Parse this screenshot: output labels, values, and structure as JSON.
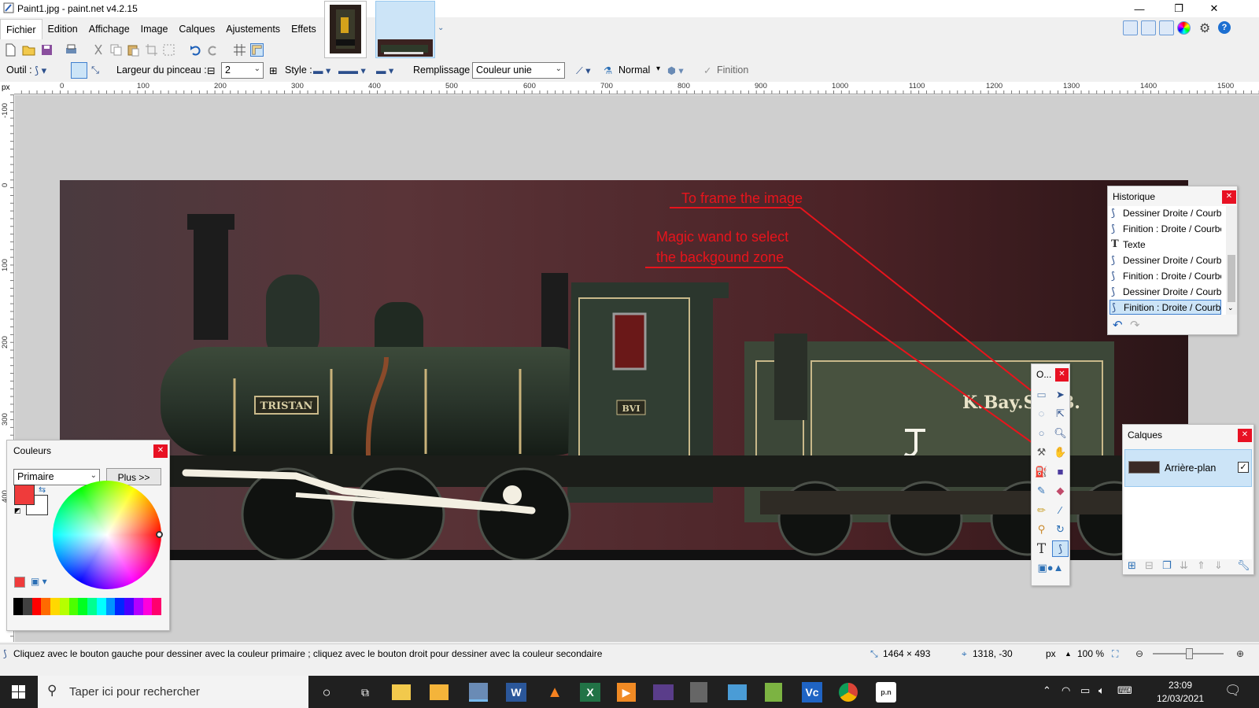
{
  "window": {
    "title": "Paint1.jpg - paint.net v4.2.15",
    "minimize": "—",
    "restore": "❐",
    "close": "✕"
  },
  "menu": [
    "Fichier",
    "Edition",
    "Affichage",
    "Image",
    "Calques",
    "Ajustements",
    "Effets"
  ],
  "toolbar2": {
    "tool_label": "Outil :",
    "brush_width_label": "Largeur du pinceau :",
    "brush_width_value": "2",
    "style_label": "Style :",
    "fill_label": "Remplissage :",
    "fill_value": "Couleur unie",
    "blend_mode": "Normal",
    "finish_label": "Finition"
  },
  "rulers": {
    "unit": "px",
    "h_labels": [
      "0",
      "100",
      "200",
      "300",
      "400",
      "500",
      "600",
      "700",
      "800",
      "900",
      "1000",
      "1100",
      "1200",
      "1300",
      "1400",
      "1500"
    ],
    "v_labels": [
      "-100",
      "0",
      "100",
      "200",
      "300",
      "400"
    ]
  },
  "annotations": {
    "frame": "To frame the image",
    "wand_line1": "Magic wand to select",
    "wand_line2": "the backgound zone",
    "color": "#e8141c"
  },
  "history": {
    "title": "Historique",
    "items": [
      {
        "icon": "draw-line-icon",
        "label": "Dessiner Droite / Courbe",
        "selected": false
      },
      {
        "icon": "finish-line-icon",
        "label": "Finition : Droite / Courbe",
        "selected": false
      },
      {
        "icon": "text-icon",
        "label": "Texte",
        "selected": false
      },
      {
        "icon": "draw-line-icon",
        "label": "Dessiner Droite / Courbe",
        "selected": false
      },
      {
        "icon": "finish-line-icon",
        "label": "Finition : Droite / Courbe",
        "selected": false
      },
      {
        "icon": "draw-line-icon",
        "label": "Dessiner Droite / Courbe",
        "selected": false
      },
      {
        "icon": "finish-line-icon",
        "label": "Finition : Droite / Courbe",
        "selected": true
      }
    ]
  },
  "tools_panel": {
    "title": "O..."
  },
  "layers": {
    "title": "Calques",
    "items": [
      {
        "label": "Arrière-plan",
        "visible": true
      }
    ]
  },
  "colors": {
    "title": "Couleurs",
    "mode": "Primaire",
    "more_button": "Plus >>",
    "primary_color": "#ef3b3b",
    "secondary_color": "#ffffff",
    "palette": [
      "#000000",
      "#404040",
      "#ff0000",
      "#ff6a00",
      "#ffd800",
      "#b6ff00",
      "#4cff00",
      "#00ff21",
      "#00ff90",
      "#00ffff",
      "#0094ff",
      "#0026ff",
      "#4800ff",
      "#b200ff",
      "#ff00dc",
      "#ff006e"
    ]
  },
  "status": {
    "hint": "Cliquez avec le bouton gauche pour dessiner avec la couleur primaire ; cliquez avec le bouton droit pour dessiner avec la couleur secondaire",
    "image_size": "1464 × 493",
    "cursor_pos": "1318, -30",
    "unit": "px",
    "zoom": "100 %"
  },
  "taskbar": {
    "search_placeholder": "Taper ici pour rechercher",
    "time": "23:09",
    "date": "12/03/2021"
  }
}
